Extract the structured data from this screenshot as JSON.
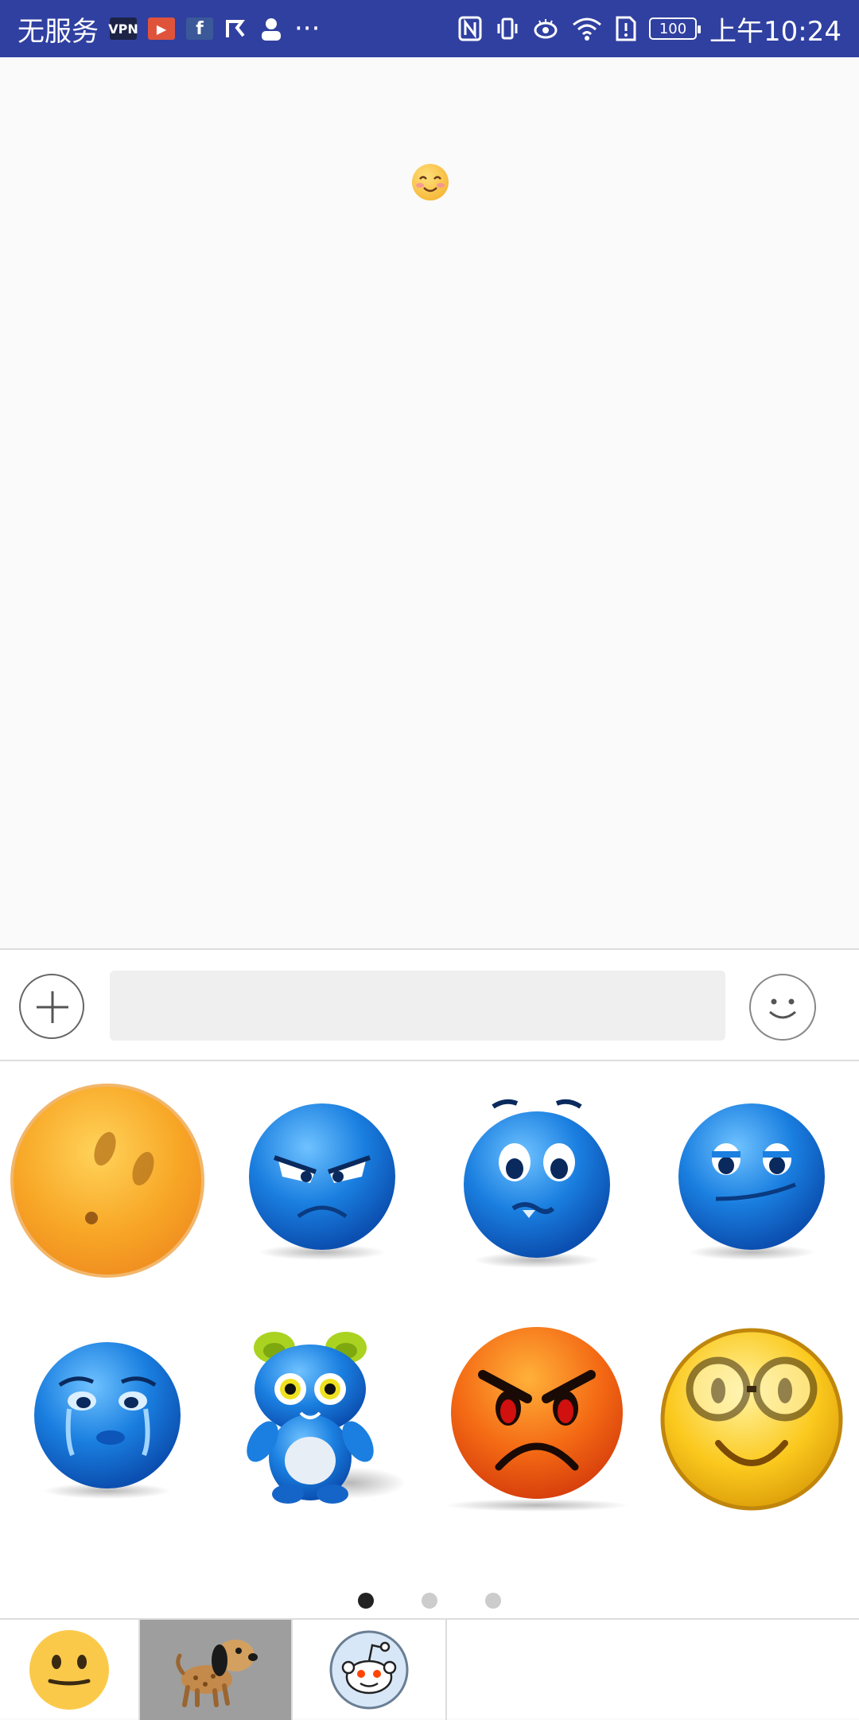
{
  "status_bar": {
    "carrier": "无服务",
    "battery": "100",
    "time": "上午10:24",
    "overflow": "···",
    "icons": [
      "vpn-icon",
      "video-icon",
      "facebook-icon",
      "check-flag-icon",
      "person-icon",
      "nfc-icon",
      "vibrate-icon",
      "eye-icon",
      "wifi-icon",
      "sim-alert-icon",
      "battery-icon"
    ]
  },
  "chat": {
    "message_emoji": "smiling-face-blush-icon"
  },
  "input_bar": {
    "text_value": "",
    "placeholder": "",
    "plus_icon": "plus-icon",
    "emoji_icon": "smiley-outline-icon"
  },
  "emoji_panel": {
    "items": [
      "orange-surprised-face",
      "blue-angry-face",
      "blue-lip-bite-face",
      "blue-smirk-face",
      "blue-crying-face",
      "blue-monster-character",
      "orange-angry-face",
      "yellow-glasses-smile-face"
    ],
    "page_count": 3,
    "active_page": 0,
    "colors": {
      "blue": "#1a7fe0",
      "orange": "#f7a12a",
      "yellow": "#f9c21a"
    }
  },
  "tabs": {
    "items": [
      "yellow-smiley-tab",
      "dog-sticker-tab",
      "reddit-alien-tab"
    ],
    "selected": 1
  }
}
